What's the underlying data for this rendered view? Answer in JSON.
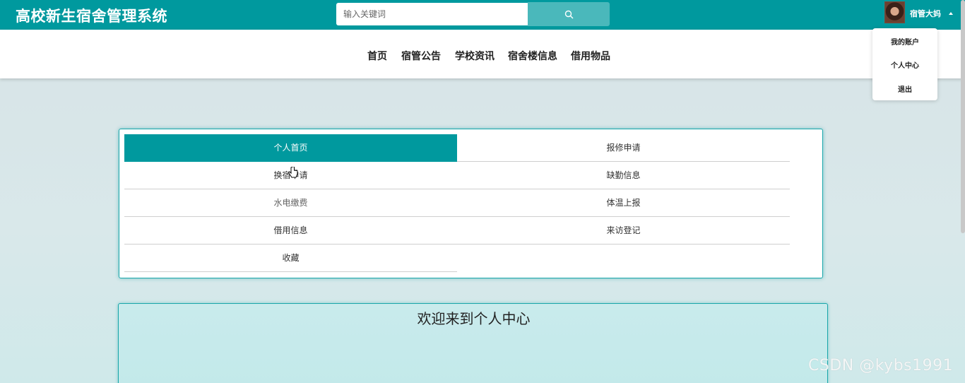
{
  "header": {
    "title": "高校新生宿舍管理系统",
    "search_placeholder": "输入关键词",
    "search_icon": "search-icon",
    "username": "宿管大妈"
  },
  "nav": {
    "items": [
      {
        "label": "首页"
      },
      {
        "label": "宿管公告"
      },
      {
        "label": "学校资讯"
      },
      {
        "label": "宿舍楼信息"
      },
      {
        "label": "借用物品"
      }
    ]
  },
  "user_dropdown": {
    "items": [
      {
        "label": "我的账户"
      },
      {
        "label": "个人中心"
      },
      {
        "label": "退出"
      }
    ]
  },
  "center_menu": {
    "items": [
      {
        "label": "个人首页",
        "active": true
      },
      {
        "label": "报修申请"
      },
      {
        "label": "换宿申请"
      },
      {
        "label": "缺勤信息"
      },
      {
        "label": "水电缴费"
      },
      {
        "label": "体温上报"
      },
      {
        "label": "借用信息"
      },
      {
        "label": "来访登记"
      },
      {
        "label": "收藏"
      }
    ]
  },
  "welcome": {
    "title": "欢迎来到个人中心"
  },
  "watermark": "CSDN @kybs1991",
  "colors": {
    "primary": "#00999e",
    "search_button": "#4ab8bb"
  }
}
